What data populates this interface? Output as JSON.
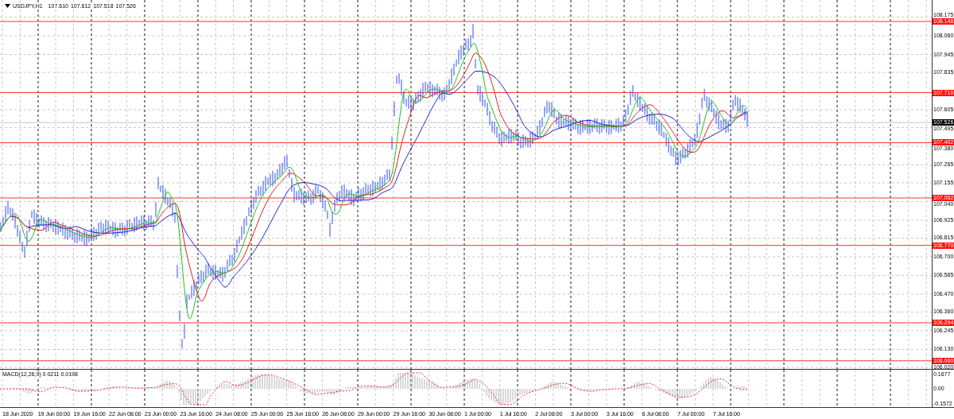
{
  "chart": {
    "symbol": "USDJPY,H1",
    "ohlc": [
      "107.610",
      "107.612",
      "107.518",
      "107.526"
    ],
    "price_ticks": [
      "108.175",
      "108.060",
      "107.945",
      "107.835",
      "107.605",
      "107.495",
      "107.380",
      "107.265",
      "107.155",
      "107.040",
      "106.925",
      "106.815",
      "106.700",
      "106.585",
      "106.470",
      "106.360",
      "106.245",
      "106.130",
      "106.020"
    ],
    "levels": [
      "108.148",
      "107.710",
      "107.402",
      "107.062",
      "106.770",
      "106.294",
      "106.060"
    ],
    "current_price": "107.526",
    "macd": {
      "title": "MACD(12,26,9) 0.0211 0.0198",
      "ticks": [
        "0.1677",
        "0.00",
        "-0.1572"
      ]
    },
    "time_labels": [
      "18 Jun 2020",
      "19 Jun 00:00",
      "19 Jun 16:00",
      "22 Jun 08:00",
      "23 Jun 00:00",
      "23 Jun 16:00",
      "24 Jun 08:00",
      "25 Jun 00:00",
      "25 Jun 16:00",
      "26 Jun 08:00",
      "29 Jun 00:00",
      "29 Jun 16:00",
      "30 Jun 08:00",
      "1 Jul 00:00",
      "1 Jul 16:00",
      "2 Jul 08:00",
      "3 Jul 00:00",
      "3 Jul 16:00",
      "6 Jul 08:00",
      "7 Jul 00:00",
      "7 Jul 16:00"
    ]
  }
}
